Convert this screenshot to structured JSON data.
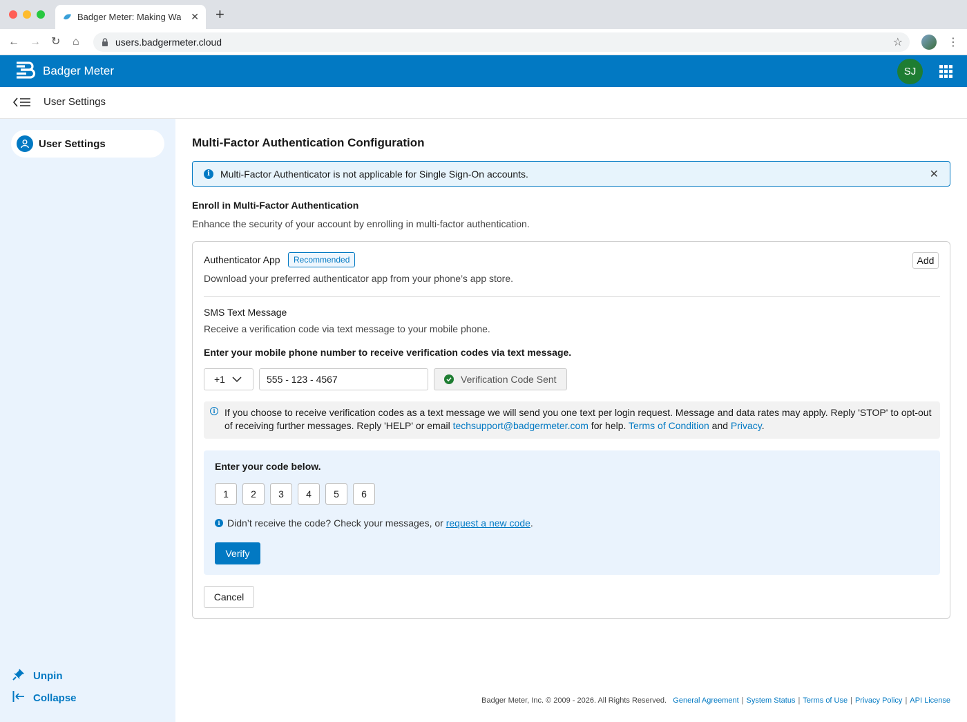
{
  "browser": {
    "tab_title": "Badger Meter: Making Wat",
    "url": "users.badgermeter.cloud",
    "colors": {
      "close": "#ff5f57",
      "minimize": "#febc2e",
      "maximize": "#28c840"
    }
  },
  "header": {
    "brand": "Badger Meter",
    "avatar_initials": "SJ",
    "color": "#0279c3"
  },
  "subheader": {
    "title": "User Settings"
  },
  "sidebar": {
    "items": [
      {
        "label": "User Settings",
        "icon": "user-icon"
      }
    ],
    "unpin": "Unpin",
    "collapse": "Collapse"
  },
  "main": {
    "title": "Multi-Factor Authentication Configuration",
    "alert": "Multi-Factor Authenticator is not applicable for Single Sign-On accounts.",
    "enroll_title": "Enroll in Multi-Factor Authentication",
    "enroll_desc": "Enhance the security of your account by enrolling in multi-factor authentication.",
    "app": {
      "title": "Authenticator App",
      "badge": "Recommended",
      "add": "Add",
      "desc": "Download your preferred authenticator app from your phone’s app store."
    },
    "sms": {
      "title": "SMS Text Message",
      "desc": "Receive a verification code via text message to your mobile phone.",
      "prompt": "Enter your mobile phone number to receive verification codes via text message.",
      "country_code": "+1",
      "phone": "555 - 123 - 4567",
      "sent": "Verification Code Sent",
      "notice_pre": "If you choose to receive verification codes as a text message we will send you one text per login request. Message and data rates may apply. Reply 'STOP' to opt-out of receiving further messages. Reply 'HELP' or email ",
      "notice_email": "techsupport@badgermeter.com",
      "notice_mid": " for help. ",
      "notice_terms": "Terms of Condition",
      "notice_and": " and ",
      "notice_privacy": "Privacy",
      "notice_end": "."
    },
    "code": {
      "title": "Enter your code below.",
      "digits": [
        "1",
        "2",
        "3",
        "4",
        "5",
        "6"
      ],
      "resend_pre": "Didn’t receive the code? Check your messages, or ",
      "resend_link": "request a new code",
      "resend_end": ".",
      "verify": "Verify"
    },
    "cancel": "Cancel"
  },
  "footer": {
    "copyright": "Badger Meter, Inc. © 2009 - 2026. All Rights Reserved.",
    "links": [
      "General Agreement",
      "System Status",
      "Terms of Use",
      "Privacy Policy",
      "API License"
    ]
  }
}
